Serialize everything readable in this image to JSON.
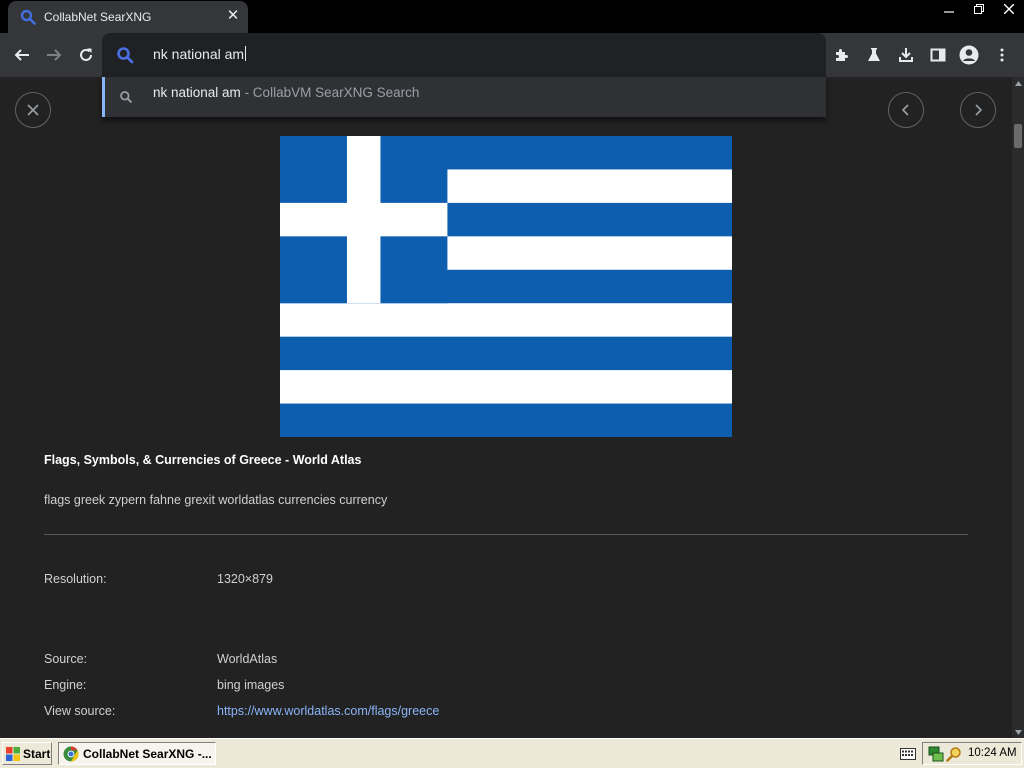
{
  "browser": {
    "tab": {
      "title": "CollabNet SearXNG"
    },
    "omnibox": {
      "value": "nk national am"
    },
    "suggestion": {
      "query": "nk national am",
      "source": " - CollabVM SearXNG Search"
    }
  },
  "result": {
    "title": "Flags, Symbols, & Currencies of Greece - World Atlas",
    "description": "flags greek zypern fahne grexit worldatlas currencies currency",
    "details": {
      "resolution_label": "Resolution:",
      "resolution_value": "1320×879",
      "source_label": "Source:",
      "source_value": "WorldAtlas",
      "engine_label": "Engine:",
      "engine_value": "bing images",
      "view_source_label": "View source:",
      "view_source_value": "https://www.worldatlas.com/flags/greece"
    }
  },
  "icons": {
    "close_detail": "close-icon",
    "prev": "chevron-left-icon",
    "next": "chevron-right-icon"
  },
  "colors": {
    "flag_blue": "#0d5eaf",
    "flag_white": "#ffffff",
    "link": "#8ab4f8",
    "accent_search": "#4169e1"
  },
  "taskbar": {
    "start_label": "Start",
    "task_label": "CollabNet SearXNG -...",
    "clock": "10:24 AM"
  }
}
